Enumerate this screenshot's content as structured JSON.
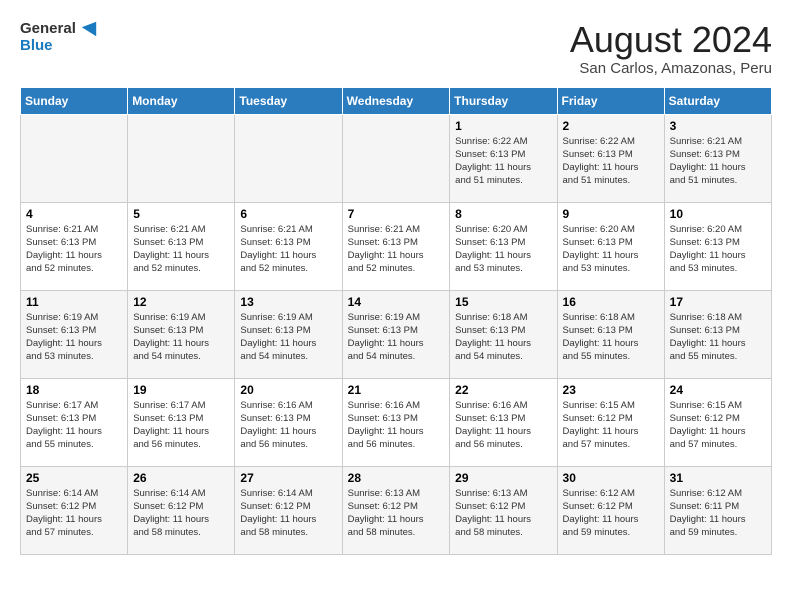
{
  "logo": {
    "line1": "General",
    "line2": "Blue"
  },
  "title": "August 2024",
  "location": "San Carlos, Amazonas, Peru",
  "days_of_week": [
    "Sunday",
    "Monday",
    "Tuesday",
    "Wednesday",
    "Thursday",
    "Friday",
    "Saturday"
  ],
  "weeks": [
    [
      {
        "day": "",
        "info": ""
      },
      {
        "day": "",
        "info": ""
      },
      {
        "day": "",
        "info": ""
      },
      {
        "day": "",
        "info": ""
      },
      {
        "day": "1",
        "info": "Sunrise: 6:22 AM\nSunset: 6:13 PM\nDaylight: 11 hours\nand 51 minutes."
      },
      {
        "day": "2",
        "info": "Sunrise: 6:22 AM\nSunset: 6:13 PM\nDaylight: 11 hours\nand 51 minutes."
      },
      {
        "day": "3",
        "info": "Sunrise: 6:21 AM\nSunset: 6:13 PM\nDaylight: 11 hours\nand 51 minutes."
      }
    ],
    [
      {
        "day": "4",
        "info": "Sunrise: 6:21 AM\nSunset: 6:13 PM\nDaylight: 11 hours\nand 52 minutes."
      },
      {
        "day": "5",
        "info": "Sunrise: 6:21 AM\nSunset: 6:13 PM\nDaylight: 11 hours\nand 52 minutes."
      },
      {
        "day": "6",
        "info": "Sunrise: 6:21 AM\nSunset: 6:13 PM\nDaylight: 11 hours\nand 52 minutes."
      },
      {
        "day": "7",
        "info": "Sunrise: 6:21 AM\nSunset: 6:13 PM\nDaylight: 11 hours\nand 52 minutes."
      },
      {
        "day": "8",
        "info": "Sunrise: 6:20 AM\nSunset: 6:13 PM\nDaylight: 11 hours\nand 53 minutes."
      },
      {
        "day": "9",
        "info": "Sunrise: 6:20 AM\nSunset: 6:13 PM\nDaylight: 11 hours\nand 53 minutes."
      },
      {
        "day": "10",
        "info": "Sunrise: 6:20 AM\nSunset: 6:13 PM\nDaylight: 11 hours\nand 53 minutes."
      }
    ],
    [
      {
        "day": "11",
        "info": "Sunrise: 6:19 AM\nSunset: 6:13 PM\nDaylight: 11 hours\nand 53 minutes."
      },
      {
        "day": "12",
        "info": "Sunrise: 6:19 AM\nSunset: 6:13 PM\nDaylight: 11 hours\nand 54 minutes."
      },
      {
        "day": "13",
        "info": "Sunrise: 6:19 AM\nSunset: 6:13 PM\nDaylight: 11 hours\nand 54 minutes."
      },
      {
        "day": "14",
        "info": "Sunrise: 6:19 AM\nSunset: 6:13 PM\nDaylight: 11 hours\nand 54 minutes."
      },
      {
        "day": "15",
        "info": "Sunrise: 6:18 AM\nSunset: 6:13 PM\nDaylight: 11 hours\nand 54 minutes."
      },
      {
        "day": "16",
        "info": "Sunrise: 6:18 AM\nSunset: 6:13 PM\nDaylight: 11 hours\nand 55 minutes."
      },
      {
        "day": "17",
        "info": "Sunrise: 6:18 AM\nSunset: 6:13 PM\nDaylight: 11 hours\nand 55 minutes."
      }
    ],
    [
      {
        "day": "18",
        "info": "Sunrise: 6:17 AM\nSunset: 6:13 PM\nDaylight: 11 hours\nand 55 minutes."
      },
      {
        "day": "19",
        "info": "Sunrise: 6:17 AM\nSunset: 6:13 PM\nDaylight: 11 hours\nand 56 minutes."
      },
      {
        "day": "20",
        "info": "Sunrise: 6:16 AM\nSunset: 6:13 PM\nDaylight: 11 hours\nand 56 minutes."
      },
      {
        "day": "21",
        "info": "Sunrise: 6:16 AM\nSunset: 6:13 PM\nDaylight: 11 hours\nand 56 minutes."
      },
      {
        "day": "22",
        "info": "Sunrise: 6:16 AM\nSunset: 6:13 PM\nDaylight: 11 hours\nand 56 minutes."
      },
      {
        "day": "23",
        "info": "Sunrise: 6:15 AM\nSunset: 6:12 PM\nDaylight: 11 hours\nand 57 minutes."
      },
      {
        "day": "24",
        "info": "Sunrise: 6:15 AM\nSunset: 6:12 PM\nDaylight: 11 hours\nand 57 minutes."
      }
    ],
    [
      {
        "day": "25",
        "info": "Sunrise: 6:14 AM\nSunset: 6:12 PM\nDaylight: 11 hours\nand 57 minutes."
      },
      {
        "day": "26",
        "info": "Sunrise: 6:14 AM\nSunset: 6:12 PM\nDaylight: 11 hours\nand 58 minutes."
      },
      {
        "day": "27",
        "info": "Sunrise: 6:14 AM\nSunset: 6:12 PM\nDaylight: 11 hours\nand 58 minutes."
      },
      {
        "day": "28",
        "info": "Sunrise: 6:13 AM\nSunset: 6:12 PM\nDaylight: 11 hours\nand 58 minutes."
      },
      {
        "day": "29",
        "info": "Sunrise: 6:13 AM\nSunset: 6:12 PM\nDaylight: 11 hours\nand 58 minutes."
      },
      {
        "day": "30",
        "info": "Sunrise: 6:12 AM\nSunset: 6:12 PM\nDaylight: 11 hours\nand 59 minutes."
      },
      {
        "day": "31",
        "info": "Sunrise: 6:12 AM\nSunset: 6:11 PM\nDaylight: 11 hours\nand 59 minutes."
      }
    ]
  ]
}
